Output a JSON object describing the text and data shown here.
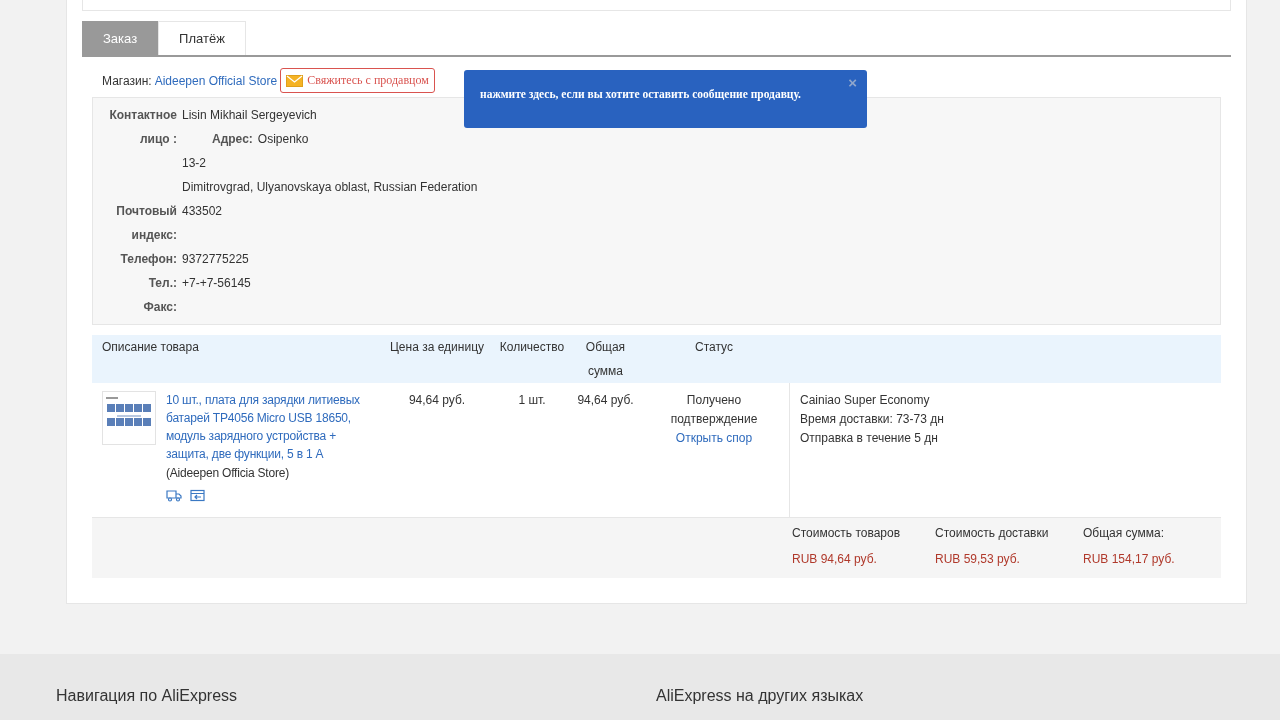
{
  "tabs": [
    {
      "label": "Заказ",
      "selected": true
    },
    {
      "label": "Платёж",
      "selected": false
    }
  ],
  "store": {
    "label": "Магазин:",
    "name": "Aideepen Official Store",
    "contact_button": "Свяжитесь с продавцом"
  },
  "tooltip": {
    "text": "нажмите здесь, если вы хотите оставить сообщение продавцу.",
    "close": "×"
  },
  "contact": {
    "person_label": "Контактное лицо :",
    "person": "Lisin Mikhail Sergeyevich",
    "address_label": "Адрес:",
    "address_lines": [
      "Osipenko",
      "13-2",
      "Dimitrovgrad, Ulyanovskaya oblast, Russian Federation"
    ],
    "fields": [
      {
        "label": "Почтовый индекс:",
        "value": "433502"
      },
      {
        "label": "Телефон:",
        "value": "9372775225"
      },
      {
        "label": "Тел.:",
        "value": "+7-+7-56145"
      },
      {
        "label": "Факс:"
      }
    ]
  },
  "table": {
    "columns": [
      "Описание товара",
      "Цена за единицу",
      "Количество",
      "Общая сумма",
      "Статус"
    ],
    "rows": [
      {
        "title": "10 шт., плата для зарядки литиевых батарей TP4056 Micro USB 18650, модуль зарядного устройства + защита, две функции, 5 в 1 A",
        "store": "(Aideepen Officia Store)",
        "price": "94,64 руб.",
        "quantity": "1 шт.",
        "total": "94,64 руб.",
        "status": "Получено подтверждение",
        "dispute_link": "Открыть спор",
        "shipping": [
          "Cainiao Super Economy",
          "Время доставки: 73-73 дн",
          "Отправка в течение 5 дн"
        ]
      }
    ]
  },
  "summary": [
    {
      "label": "Стоимость товаров",
      "value": "RUB 94,64 руб."
    },
    {
      "label": "Стоимость доставки",
      "value": "RUB 59,53 руб."
    },
    {
      "label": "Общая сумма:",
      "value": "RUB 154,17 руб."
    }
  ],
  "footer": {
    "headings": [
      "Навигация по AliExpress",
      "AliExpress на других языках"
    ]
  }
}
